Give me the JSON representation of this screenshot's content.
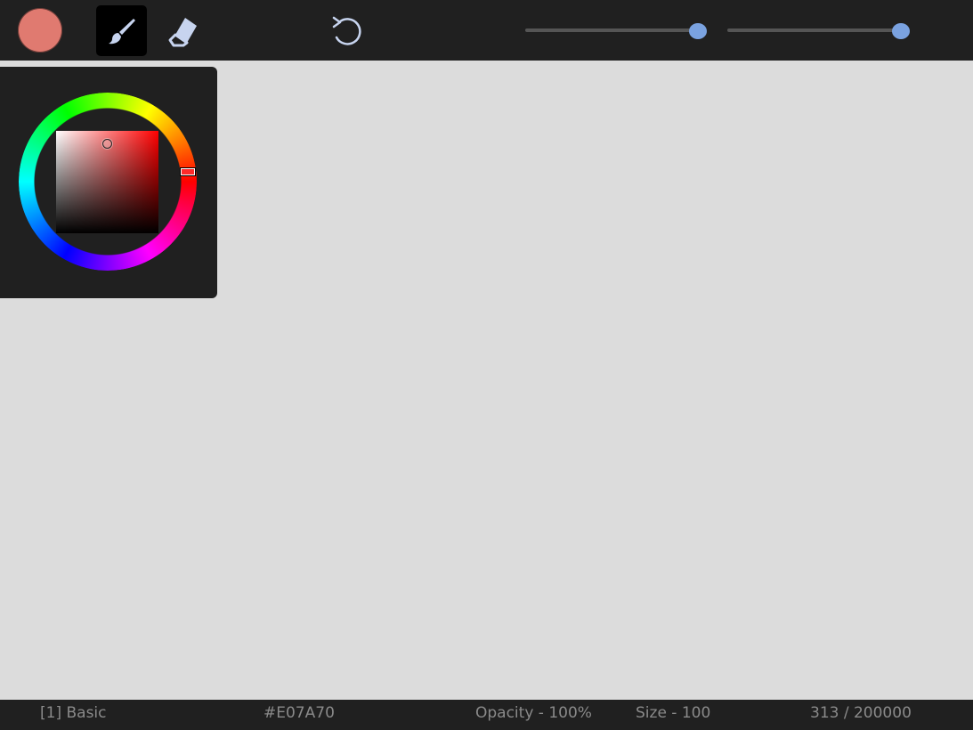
{
  "colors": {
    "current": "#E07A70",
    "accent": "#7aa2e0",
    "icon": "#b8c8e8"
  },
  "toolbar": {
    "current_color_icon": "current-color-swatch",
    "brush_icon": "paintbrush-icon",
    "eraser_icon": "eraser-icon",
    "undo_icon": "undo-icon",
    "opacity_percent": 100,
    "size_value": 100
  },
  "color_picker": {
    "hue_degrees": 5,
    "saturation_percent": 50,
    "value_percent": 88
  },
  "status": {
    "brush": "[1]  Basic",
    "hex": "#E07A70",
    "opacity": "Opacity - 100%",
    "size": "Size - 100",
    "count": "313 / 200000"
  }
}
